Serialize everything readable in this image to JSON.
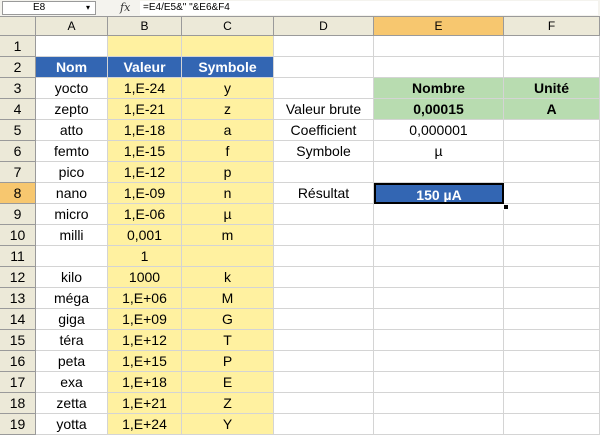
{
  "formula_bar": {
    "name_box": "E8",
    "dropdown_glyph": "▾",
    "fx_icon": "fx",
    "formula": "=E4/E5&\" \"&E6&F4"
  },
  "columns": [
    "A",
    "B",
    "C",
    "D",
    "E",
    "F"
  ],
  "rows": [
    "1",
    "2",
    "3",
    "4",
    "5",
    "6",
    "7",
    "8",
    "9",
    "10",
    "11",
    "12",
    "13",
    "14",
    "15",
    "16",
    "17",
    "18",
    "19"
  ],
  "table": {
    "headers": [
      "Nom",
      "Valeur",
      "Symbole"
    ],
    "rows": [
      [
        "yocto",
        "1,E-24",
        "y"
      ],
      [
        "zepto",
        "1,E-21",
        "z"
      ],
      [
        "atto",
        "1,E-18",
        "a"
      ],
      [
        "femto",
        "1,E-15",
        "f"
      ],
      [
        "pico",
        "1,E-12",
        "p"
      ],
      [
        "nano",
        "1,E-09",
        "n"
      ],
      [
        "micro",
        "1,E-06",
        "µ"
      ],
      [
        "milli",
        "0,001",
        "m"
      ],
      [
        "",
        "1",
        ""
      ],
      [
        "kilo",
        "1000",
        "k"
      ],
      [
        "méga",
        "1,E+06",
        "M"
      ],
      [
        "giga",
        "1,E+09",
        "G"
      ],
      [
        "téra",
        "1,E+12",
        "T"
      ],
      [
        "peta",
        "1,E+15",
        "P"
      ],
      [
        "exa",
        "1,E+18",
        "E"
      ],
      [
        "zetta",
        "1,E+21",
        "Z"
      ],
      [
        "yotta",
        "1,E+24",
        "Y"
      ]
    ]
  },
  "calc": {
    "header_nombre": "Nombre",
    "header_unite": "Unité",
    "label_valeur_brute": "Valeur brute",
    "valeur_brute": "0,00015",
    "unit": "A",
    "label_coefficient": "Coefficient",
    "coefficient": "0,000001",
    "label_symbole": "Symbole",
    "symbole": "µ",
    "label_resultat": "Résultat",
    "resultat": "150 µA"
  },
  "colors": {
    "yellow": "#fff1a0",
    "blue": "#3366b3",
    "green": "#b8dcb0",
    "header_bg": "#ece9d8",
    "selected_header": "#f7c76f"
  }
}
